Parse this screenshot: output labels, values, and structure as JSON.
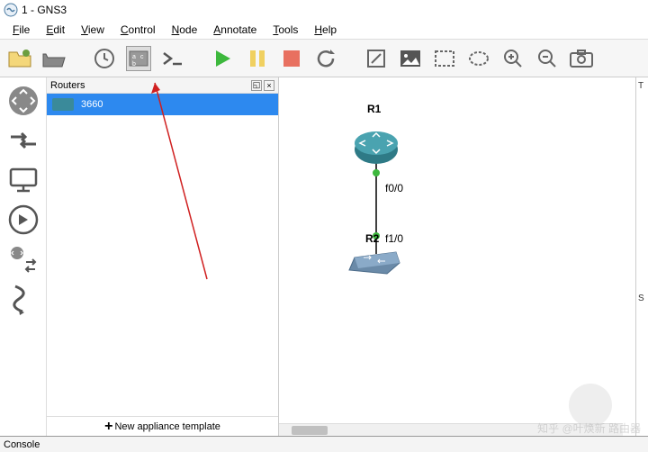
{
  "title": "1 - GNS3",
  "menu": [
    "File",
    "Edit",
    "View",
    "Control",
    "Node",
    "Annotate",
    "Tools",
    "Help"
  ],
  "devices_panel": {
    "title": "Routers",
    "items": [
      {
        "label": "3660"
      }
    ],
    "new_template": "New appliance template"
  },
  "topology": {
    "nodes": {
      "r1": {
        "label": "R1"
      },
      "r2": {
        "label": "R2"
      }
    },
    "interfaces": {
      "if1": "f0/0",
      "if2": "f1/0"
    }
  },
  "right_tabs": {
    "t": "T",
    "s": "S"
  },
  "console": {
    "title": "Console"
  },
  "watermark": "知乎 @叶焕新  路由器"
}
